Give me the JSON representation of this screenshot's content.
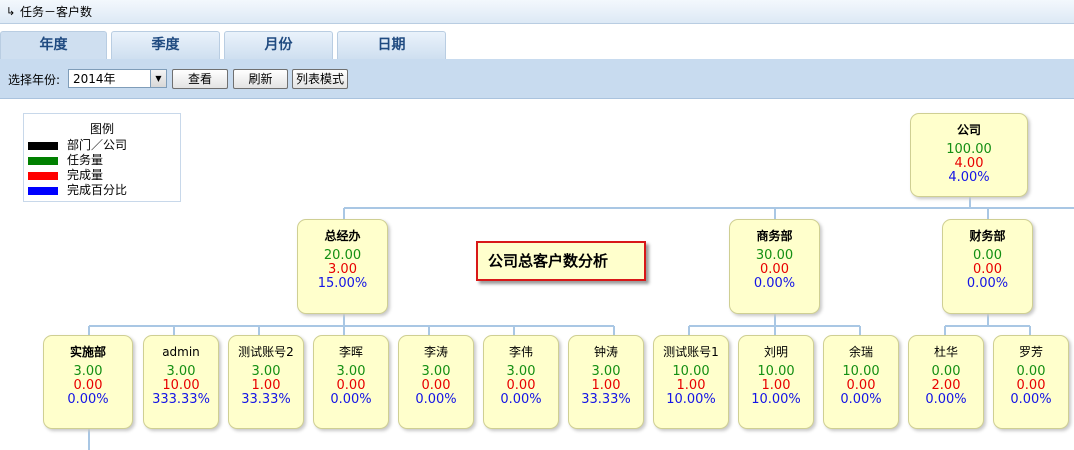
{
  "title_bar": {
    "icon": "collapse-arrow-icon",
    "text": "任务－客户数"
  },
  "tabs": [
    {
      "label": "年度",
      "active": true
    },
    {
      "label": "季度",
      "active": false
    },
    {
      "label": "月份",
      "active": false
    },
    {
      "label": "日期",
      "active": false
    }
  ],
  "toolbar": {
    "select_label": "选择年份:",
    "year_value": "2014年",
    "view_button": "查看",
    "refresh_button": "刷新",
    "list_mode_button": "列表模式"
  },
  "legend": {
    "title": "图例",
    "items": [
      {
        "label": "部门／公司",
        "color": "#000000"
      },
      {
        "label": "任务量",
        "color": "#008000"
      },
      {
        "label": "完成量",
        "color": "#ff0000"
      },
      {
        "label": "完成百分比",
        "color": "#0000ff"
      }
    ]
  },
  "chart_title": "公司总客户数分析",
  "colors": {
    "node_bg": "#ffffcc",
    "task": "#138f13",
    "done": "#e80000",
    "percent": "#1414e6",
    "line": "#a9c7e4"
  },
  "org": {
    "root": {
      "name": "公司",
      "task": "100.00",
      "done": "4.00",
      "percent": "4.00%"
    },
    "departments": [
      {
        "name": "总经办",
        "task": "20.00",
        "done": "3.00",
        "percent": "15.00%"
      },
      {
        "name": "商务部",
        "task": "30.00",
        "done": "0.00",
        "percent": "0.00%"
      },
      {
        "name": "财务部",
        "task": "0.00",
        "done": "0.00",
        "percent": "0.00%"
      }
    ],
    "members": [
      {
        "name": "实施部",
        "task": "3.00",
        "done": "0.00",
        "percent": "0.00%"
      },
      {
        "name": "admin",
        "task": "3.00",
        "done": "10.00",
        "percent": "333.33%"
      },
      {
        "name": "测试账号2",
        "task": "3.00",
        "done": "1.00",
        "percent": "33.33%"
      },
      {
        "name": "李晖",
        "task": "3.00",
        "done": "0.00",
        "percent": "0.00%"
      },
      {
        "name": "李涛",
        "task": "3.00",
        "done": "0.00",
        "percent": "0.00%"
      },
      {
        "name": "李伟",
        "task": "3.00",
        "done": "0.00",
        "percent": "0.00%"
      },
      {
        "name": "钟涛",
        "task": "3.00",
        "done": "1.00",
        "percent": "33.33%"
      },
      {
        "name": "测试账号1",
        "task": "10.00",
        "done": "1.00",
        "percent": "10.00%"
      },
      {
        "name": "刘明",
        "task": "10.00",
        "done": "1.00",
        "percent": "10.00%"
      },
      {
        "name": "余瑞",
        "task": "10.00",
        "done": "0.00",
        "percent": "0.00%"
      },
      {
        "name": "杜华",
        "task": "0.00",
        "done": "2.00",
        "percent": "0.00%"
      },
      {
        "name": "罗芳",
        "task": "0.00",
        "done": "0.00",
        "percent": "0.00%"
      }
    ]
  }
}
